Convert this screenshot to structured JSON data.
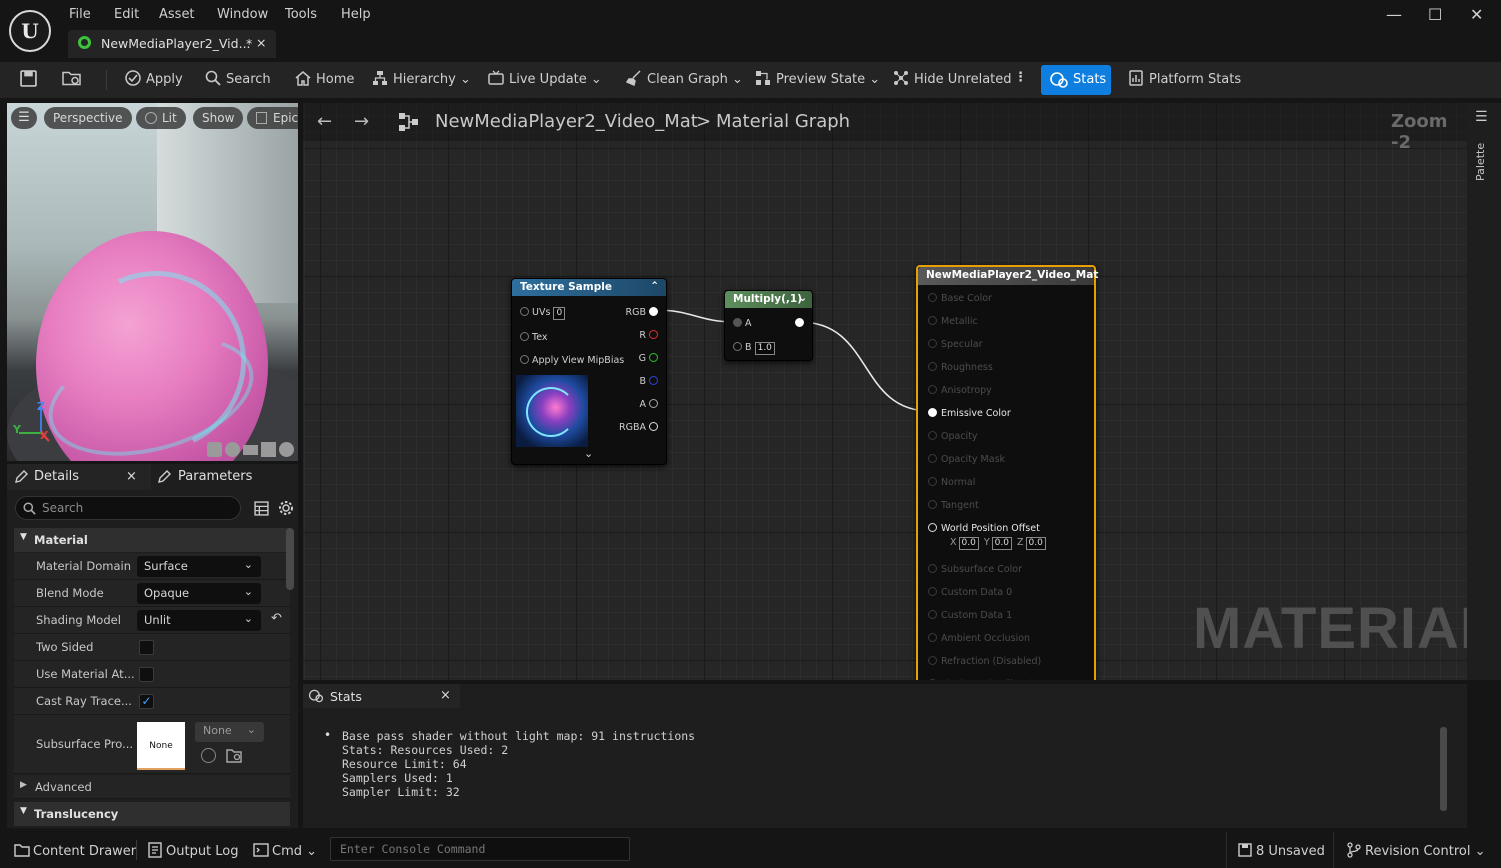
{
  "menu": [
    "File",
    "Edit",
    "Asset",
    "Window",
    "Tools",
    "Help"
  ],
  "document_tab": {
    "title": "NewMediaPlayer2_Vid...",
    "modified": "*",
    "close": "×"
  },
  "window_controls": {
    "minimize": "—",
    "maximize": "☐",
    "close": "✕"
  },
  "toolbar": {
    "apply": "Apply",
    "search": "Search",
    "home": "Home",
    "hierarchy": "Hierarchy",
    "live_update": "Live Update",
    "clean_graph": "Clean Graph",
    "preview_state": "Preview State",
    "hide_unrelated": "Hide Unrelated",
    "stats": "Stats",
    "platform_stats": "Platform Stats",
    "accent": "#0e7fe0"
  },
  "viewport": {
    "perspective": "Perspective",
    "lit": "Lit",
    "show": "Show",
    "epic": "Epic",
    "axis_x": "X",
    "axis_y": "Y",
    "axis_z": "Z"
  },
  "details_panel": {
    "tab_details": "Details",
    "tab_parameters": "Parameters",
    "close": "×",
    "search_placeholder": "Search",
    "section_material": "Material",
    "rows": [
      {
        "label": "Material Domain",
        "value": "Surface"
      },
      {
        "label": "Blend Mode",
        "value": "Opaque"
      },
      {
        "label": "Shading Model",
        "value": "Unlit"
      },
      {
        "label": "Two Sided",
        "checked": false
      },
      {
        "label": "Use Material At...",
        "checked": false
      },
      {
        "label": "Cast Ray Trace...",
        "checked": true
      },
      {
        "label": "Subsurface Pro...",
        "thumb": "None",
        "dropdown": "None"
      }
    ],
    "section_advanced": "Advanced",
    "section_translucency": "Translucency"
  },
  "graph": {
    "breadcrumb_asset": "NewMediaPlayer2_Video_Mat",
    "breadcrumb_sep": ">",
    "breadcrumb_graph": "Material Graph",
    "zoom": "Zoom -2",
    "watermark": "MATERIAL",
    "palette": "Palette",
    "texture_node": {
      "title": "Texture Sample",
      "uvs": "UVs",
      "uv_index": "0",
      "tex": "Tex",
      "mipbias": "Apply View MipBias",
      "outputs": [
        "RGB",
        "R",
        "G",
        "B",
        "A",
        "RGBA"
      ],
      "collapse": "⌄"
    },
    "multiply_node": {
      "title": "Multiply(,1)",
      "in_a": "A",
      "in_b": "B",
      "b_value": "1.0"
    },
    "material_node": {
      "title": "NewMediaPlayer2_Video_Mat",
      "pins": [
        "Base Color",
        "Metallic",
        "Specular",
        "Roughness",
        "Anisotropy",
        "Emissive Color",
        "Opacity",
        "Opacity Mask",
        "Normal",
        "Tangent",
        "World Position Offset",
        "Subsurface Color",
        "Custom Data 0",
        "Custom Data 1",
        "Ambient Occlusion",
        "Refraction (Disabled)",
        "Pixel Depth Offset (Custom Usage)"
      ],
      "wpo_x": "X",
      "wpo_y": "Y",
      "wpo_z": "Z",
      "wpo_value": "0.0"
    }
  },
  "stats_panel": {
    "tab": "Stats",
    "close": "×",
    "bullet_line": "Base pass shader without light map: 91 instructions",
    "lines": [
      "Stats: Resources Used: 2",
      "Resource Limit: 64",
      "Samplers Used: 1",
      "Sampler Limit: 32"
    ]
  },
  "statusbar": {
    "content_drawer": "Content Drawer",
    "output_log": "Output Log",
    "cmd": "Cmd",
    "console_placeholder": "Enter Console Command",
    "unsaved": "8 Unsaved",
    "revision_control": "Revision Control"
  }
}
